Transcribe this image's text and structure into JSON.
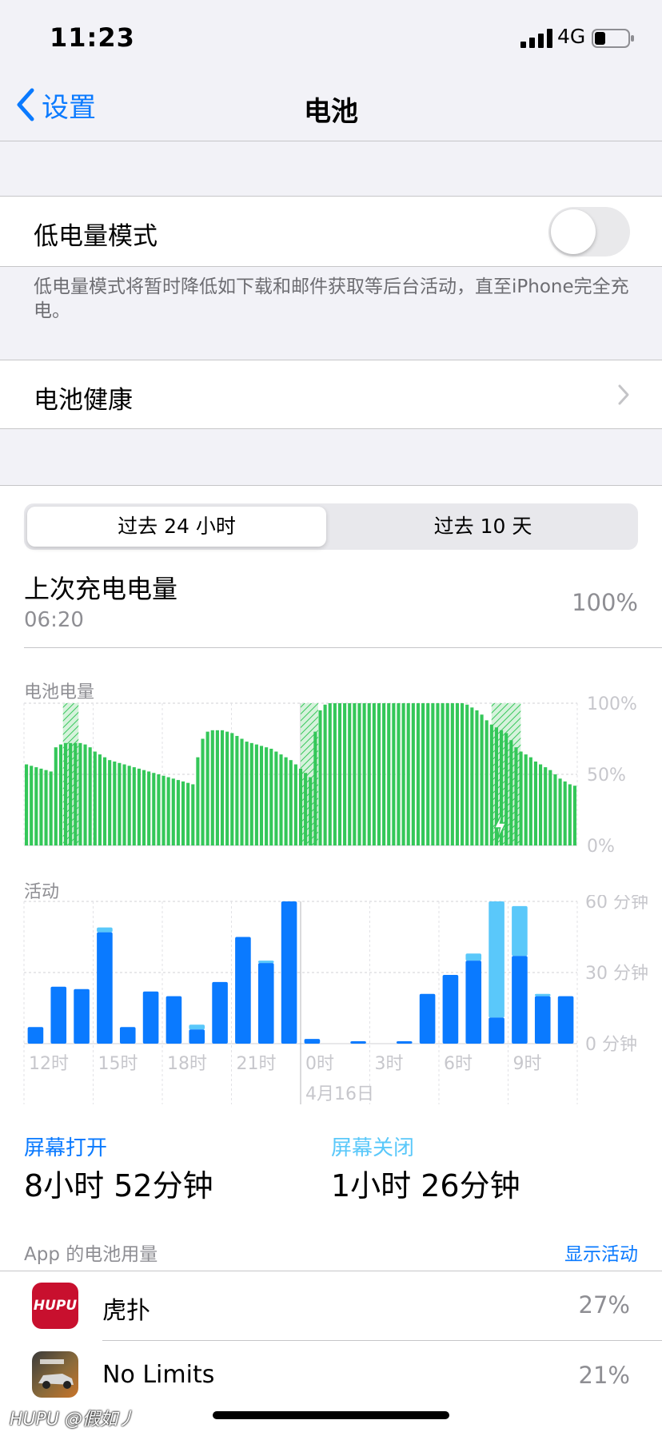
{
  "status_bar": {
    "time": "11:23",
    "network": "4G",
    "battery_level": 0.33
  },
  "nav": {
    "back_label": "设置",
    "title": "电池"
  },
  "low_power": {
    "label": "低电量模式",
    "enabled": false,
    "description": "低电量模式将暂时降低如下载和邮件获取等后台活动，直至iPhone完全充电。"
  },
  "battery_health": {
    "label": "电池健康"
  },
  "segment": {
    "options": [
      "过去 24 小时",
      "过去 10 天"
    ],
    "selected": 0
  },
  "last_charge": {
    "title": "上次充电电量",
    "time": "06:20",
    "value": "100%"
  },
  "colors": {
    "accent": "#0a7aff",
    "battery_green": "#34c759",
    "activity_screen_on": "#0a7aff",
    "activity_screen_off": "#5ac8fa"
  },
  "chart_data": [
    {
      "type": "bar",
      "title": "电池电量",
      "y_ticks": [
        "100%",
        "50%",
        "0%"
      ],
      "ylim": [
        0,
        100
      ],
      "x_span_hours": 24,
      "charging_segments": [
        [
          2.0,
          2.8
        ],
        [
          14.2,
          15.1
        ],
        [
          24.0,
          25.5
        ]
      ],
      "charge_icon_at": 24.4,
      "values": [
        57,
        56,
        55,
        54,
        53,
        52,
        69,
        71,
        72,
        72,
        72,
        72,
        71,
        69,
        66,
        64,
        62,
        60,
        59,
        58,
        57,
        56,
        55,
        54,
        53,
        52,
        51,
        50,
        49,
        48,
        47,
        46,
        45,
        44,
        43,
        62,
        75,
        80,
        81,
        81,
        81,
        80,
        79,
        77,
        75,
        73,
        72,
        71,
        70,
        69,
        68,
        66,
        64,
        62,
        60,
        57,
        54,
        51,
        48,
        80,
        95,
        99,
        100,
        100,
        100,
        100,
        100,
        100,
        100,
        100,
        100,
        100,
        100,
        100,
        100,
        100,
        100,
        100,
        100,
        100,
        100,
        100,
        100,
        100,
        100,
        100,
        100,
        100,
        100,
        100,
        99,
        97,
        95,
        92,
        88,
        85,
        83,
        81,
        79,
        74,
        69,
        66,
        64,
        62,
        59,
        57,
        55,
        53,
        50,
        47,
        45,
        43,
        42
      ]
    },
    {
      "type": "bar",
      "title": "活动",
      "y_ticks": [
        "60 分钟",
        "30 分钟",
        "0 分钟"
      ],
      "ylim": [
        0,
        60
      ],
      "x_ticks": [
        "12时",
        "15时",
        "18时",
        "21时",
        "0时",
        "3时",
        "6时",
        "9时"
      ],
      "date_label": "4月16日",
      "series": [
        {
          "name": "屏幕打开",
          "values": [
            7,
            24,
            23,
            47,
            7,
            22,
            20,
            6,
            26,
            45,
            34,
            60,
            2,
            0,
            1,
            0,
            1,
            21,
            29,
            35,
            11,
            37,
            20,
            20
          ]
        },
        {
          "name": "屏幕关闭",
          "values": [
            0,
            0,
            0,
            2,
            0,
            0,
            0,
            2,
            0,
            0,
            1,
            0,
            0,
            0,
            0,
            0,
            0,
            0,
            0,
            3,
            49,
            21,
            1,
            0
          ]
        }
      ]
    }
  ],
  "screen_on": {
    "label": "屏幕打开",
    "value": "8小时 52分钟"
  },
  "screen_off": {
    "label": "屏幕关闭",
    "value": "1小时 26分钟"
  },
  "app_usage": {
    "title": "App 的电池用量",
    "action": "显示活动"
  },
  "apps": [
    {
      "name": "虎扑",
      "percent": "27%",
      "icon_text": "HUPU",
      "icon": "hupu-app-icon"
    },
    {
      "name": "No Limits",
      "percent": "21%",
      "icon": "need-for-speed-app-icon"
    }
  ],
  "watermark": "HUPU @假如丿"
}
